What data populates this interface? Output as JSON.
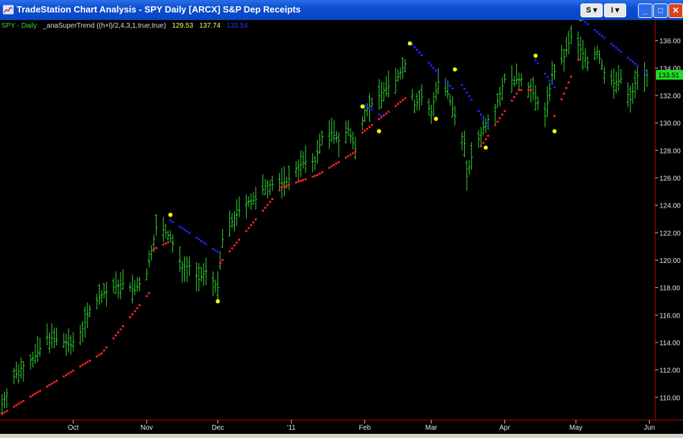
{
  "window": {
    "title": "TradeStation Chart Analysis - SPY Daily [ARCX] S&P Dep Receipts",
    "btn_s": "S",
    "btn_i": "I",
    "minimize": "_",
    "maximize": "□",
    "close": "✕"
  },
  "legend": {
    "symbol": "SPY - Daily",
    "indicator": "_anaSuperTrend ((h+l)/2,4,3,1,true,true)",
    "val1": "129.53",
    "val2": "137.74",
    "val3": "133.54"
  },
  "colors": {
    "price_bar": "#33dd33",
    "support": "#ff2222",
    "resistance": "#2222ff",
    "signal": "#ffff00",
    "grid_line": "#cc0000",
    "legend_symbol": "#33dd33",
    "legend_val1": "#ffff66",
    "legend_val2": "#ffff66",
    "legend_val3": "#3333ff",
    "last_price_bg": "#22dd22"
  },
  "chart_data": {
    "type": "ohlc-bar",
    "last_price": "133.51",
    "x": {
      "type": "date",
      "start": "2010-09-01",
      "end": "2011-05-31",
      "tick_labels": [
        "Oct",
        "Nov",
        "Dec",
        "'11",
        "Feb",
        "Mar",
        "Apr",
        "May",
        "Jun"
      ],
      "tick_dates": [
        "2010-10-01",
        "2010-11-01",
        "2010-12-01",
        "2011-01-01",
        "2011-02-01",
        "2011-03-01",
        "2011-04-01",
        "2011-05-01",
        "2011-06-01"
      ]
    },
    "y": {
      "min": 108.5,
      "max": 137.5,
      "tick_labels": [
        "110.00",
        "112.00",
        "114.00",
        "116.00",
        "118.00",
        "120.00",
        "122.00",
        "124.00",
        "126.00",
        "128.00",
        "130.00",
        "132.00",
        "134.00",
        "136.00"
      ],
      "tick_values": [
        110,
        112,
        114,
        116,
        118,
        120,
        122,
        124,
        126,
        128,
        130,
        132,
        134,
        136
      ],
      "axis_side": "right"
    },
    "close_series": {
      "name": "SPY - Daily",
      "points": [
        [
          "2010-09-01",
          109.5
        ],
        [
          "2010-09-06",
          111.5
        ],
        [
          "2010-09-10",
          112.3
        ],
        [
          "2010-09-15",
          113
        ],
        [
          "2010-09-20",
          114.4
        ],
        [
          "2010-09-24",
          114.2
        ],
        [
          "2010-09-30",
          113.8
        ],
        [
          "2010-10-05",
          115
        ],
        [
          "2010-10-08",
          116.4
        ],
        [
          "2010-10-13",
          117.5
        ],
        [
          "2010-10-18",
          118
        ],
        [
          "2010-10-22",
          118.3
        ],
        [
          "2010-10-27",
          117.8
        ],
        [
          "2010-11-01",
          119
        ],
        [
          "2010-11-05",
          122.4
        ],
        [
          "2010-11-08",
          122.2
        ],
        [
          "2010-11-11",
          121.6
        ],
        [
          "2010-11-16",
          119.5
        ],
        [
          "2010-11-19",
          119.6
        ],
        [
          "2010-11-23",
          118.6
        ],
        [
          "2010-11-26",
          119.2
        ],
        [
          "2010-12-01",
          118
        ],
        [
          "2010-12-03",
          121.5
        ],
        [
          "2010-12-07",
          122.8
        ],
        [
          "2010-12-10",
          123.6
        ],
        [
          "2010-12-14",
          124.3
        ],
        [
          "2010-12-17",
          124.4
        ],
        [
          "2010-12-21",
          125.4
        ],
        [
          "2010-12-23",
          125.5
        ],
        [
          "2010-12-30",
          125.7
        ],
        [
          "2011-01-04",
          126.9
        ],
        [
          "2011-01-07",
          127.2
        ],
        [
          "2011-01-11",
          127.2
        ],
        [
          "2011-01-14",
          129
        ],
        [
          "2011-01-18",
          129.3
        ],
        [
          "2011-01-21",
          128.7
        ],
        [
          "2011-01-25",
          129.5
        ],
        [
          "2011-01-28",
          128.1
        ],
        [
          "2011-02-01",
          130.9
        ],
        [
          "2011-02-04",
          131.4
        ],
        [
          "2011-02-09",
          132.4
        ],
        [
          "2011-02-14",
          133.1
        ],
        [
          "2011-02-18",
          134.3
        ],
        [
          "2011-02-22",
          131.3
        ],
        [
          "2011-02-25",
          131.9
        ],
        [
          "2011-03-01",
          130.8
        ],
        [
          "2011-03-04",
          133
        ],
        [
          "2011-03-08",
          132.1
        ],
        [
          "2011-03-10",
          131
        ],
        [
          "2011-03-15",
          128.5
        ],
        [
          "2011-03-16",
          126.1
        ],
        [
          "2011-03-18",
          127.5
        ],
        [
          "2011-03-23",
          129.7
        ],
        [
          "2011-03-28",
          131.1
        ],
        [
          "2011-04-01",
          133.2
        ],
        [
          "2011-04-05",
          133.1
        ],
        [
          "2011-04-08",
          133.2
        ],
        [
          "2011-04-13",
          132.2
        ],
        [
          "2011-04-18",
          130.5
        ],
        [
          "2011-04-21",
          133.5
        ],
        [
          "2011-04-26",
          134.8
        ],
        [
          "2011-04-29",
          136.3
        ],
        [
          "2011-05-02",
          135.7
        ],
        [
          "2011-05-06",
          134.4
        ],
        [
          "2011-05-10",
          135.2
        ],
        [
          "2011-05-13",
          133.7
        ],
        [
          "2011-05-17",
          132.9
        ],
        [
          "2011-05-20",
          133.2
        ],
        [
          "2011-05-24",
          131.7
        ],
        [
          "2011-05-27",
          133.5
        ]
      ]
    },
    "supertrend_support": [
      [
        "2010-09-01",
        108.8,
        "2010-10-13",
        113.2
      ],
      [
        "2010-10-13",
        113.2,
        "2010-11-02",
        117.6
      ],
      [
        "2010-11-04",
        120.8,
        "2010-11-10",
        121.3
      ],
      [
        "2010-12-02",
        119.8,
        "2010-12-28",
        125.3
      ],
      [
        "2010-12-28",
        125.3,
        "2011-01-12",
        126.2
      ],
      [
        "2011-01-12",
        126.2,
        "2011-01-28",
        127.9
      ],
      [
        "2011-01-31",
        129.3,
        "2011-02-18",
        131.8
      ],
      [
        "2011-03-22",
        128.3,
        "2011-04-07",
        132.4
      ],
      [
        "2011-04-07",
        132.4,
        "2011-04-12",
        132.4
      ],
      [
        "2011-04-22",
        130.5,
        "2011-05-02",
        134.6
      ]
    ],
    "supertrend_resistance": [
      [
        "2010-11-11",
        122.9,
        "2010-12-01",
        120.6
      ],
      [
        "2011-02-01",
        131.3,
        "2011-02-08",
        130.5
      ],
      [
        "2011-02-21",
        135.7,
        "2011-03-10",
        132.5
      ],
      [
        "2011-03-12",
        133.3,
        "2011-03-25",
        129.8
      ],
      [
        "2011-04-14",
        134.6,
        "2011-04-22",
        132.6
      ],
      [
        "2011-05-04",
        137.5,
        "2011-05-31",
        133.6
      ]
    ],
    "signals": [
      [
        "2010-11-11",
        123.3
      ],
      [
        "2010-12-01",
        117
      ],
      [
        "2011-01-31",
        131.2
      ],
      [
        "2011-02-07",
        129.4
      ],
      [
        "2011-02-20",
        135.8
      ],
      [
        "2011-03-03",
        130.3
      ],
      [
        "2011-03-11",
        133.9
      ],
      [
        "2011-03-24",
        128.2
      ],
      [
        "2011-04-14",
        134.9
      ],
      [
        "2011-04-22",
        129.4
      ],
      [
        "2011-05-03",
        137.6
      ]
    ]
  }
}
